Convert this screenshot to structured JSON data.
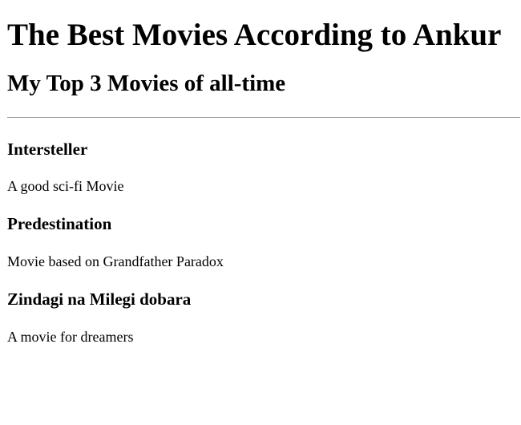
{
  "header": {
    "title": "The Best Movies According to Ankur",
    "subtitle": "My Top 3 Movies of all-time"
  },
  "movies": [
    {
      "name": "Intersteller",
      "description": "A good sci-fi Movie"
    },
    {
      "name": "Predestination",
      "description": "Movie based on Grandfather Paradox"
    },
    {
      "name": "Zindagi na Milegi dobara",
      "description": "A movie for dreamers"
    }
  ]
}
